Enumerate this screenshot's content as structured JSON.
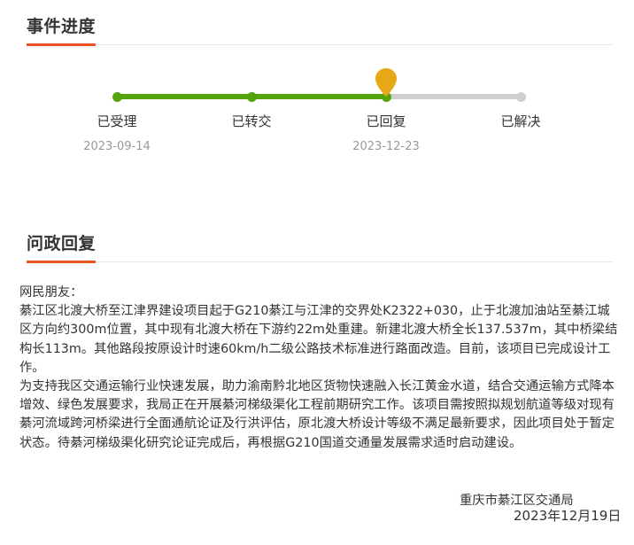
{
  "progress_section": {
    "title": "事件进度",
    "steps": [
      {
        "label": "已受理",
        "date": "2023-09-14",
        "status": "done"
      },
      {
        "label": "已转交",
        "date": "",
        "status": "done"
      },
      {
        "label": "已回复",
        "date": "2023-12-23",
        "status": "current"
      },
      {
        "label": "已解决",
        "date": "",
        "status": "pending"
      }
    ],
    "progress_fraction": 0.667,
    "current_marker_icon": "location-pin-icon"
  },
  "reply_section": {
    "title": "问政回复",
    "greeting": "网民朋友：",
    "paragraphs": [
      "綦江区北渡大桥至江津界建设项目起于G210綦江与江津的交界处K2322+030，止于北渡加油站至綦江城区方向约300m位置，其中现有北渡大桥在下游约22m处重建。新建北渡大桥全长137.537m，其中桥梁结构长113m。其他路段按原设计时速60km/h二级公路技术标准进行路面改造。目前，该项目已完成设计工作。",
      "为支持我区交通运输行业快速发展，助力渝南黔北地区货物快速融入长江黄金水道，结合交通运输方式降本增效、绿色发展要求，我局正在开展綦河梯级渠化工程前期研究工作。该项目需按照拟规划航道等级对现有綦河流域跨河桥梁进行全面通航论证及行洪评估，原北渡大桥设计等级不满足最新要求，因此项目处于暂定状态。待綦河梯级渠化研究论证完成后，再根据G210国道交通量发展需求适时启动建设。"
    ],
    "signature_org": "重庆市綦江区交通局",
    "signature_date": "2023年12月19日"
  },
  "colors": {
    "accent": "#e8531f",
    "progress_done": "#55a30a",
    "progress_pending": "#cfcfcf",
    "current_marker": "#e6a817"
  }
}
